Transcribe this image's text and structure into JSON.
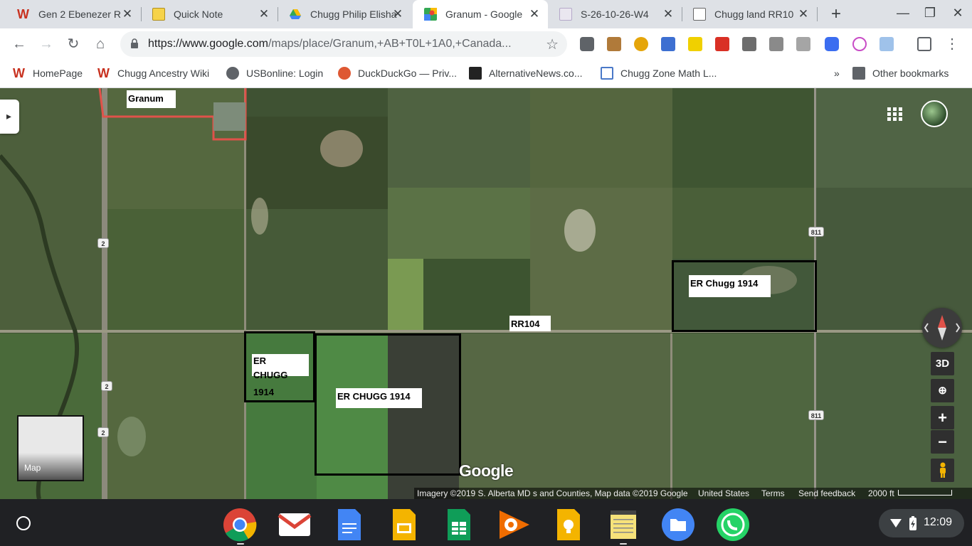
{
  "tabs": [
    {
      "title": "Gen 2 Ebenezer R",
      "icon": "wikitree-icon",
      "active": false
    },
    {
      "title": "Quick Note",
      "icon": "note-icon",
      "active": false
    },
    {
      "title": "Chugg Philip Elisha",
      "icon": "drive-icon",
      "active": false
    },
    {
      "title": "Granum - Google",
      "icon": "maps-icon",
      "active": true
    },
    {
      "title": "S-26-10-26-W4",
      "icon": "survey-icon",
      "active": false
    },
    {
      "title": "Chugg land RR10",
      "icon": "page-icon",
      "active": false
    }
  ],
  "toolbar": {
    "url_domain": "https://www.google.com",
    "url_path": "/maps/place/Granum,+AB+T0L+1A0,+Canada..."
  },
  "bookmarks": [
    {
      "label": "HomePage",
      "icon": "wikitree-icon"
    },
    {
      "label": "Chugg Ancestry Wiki",
      "icon": "wikitree-icon"
    },
    {
      "label": "USBonline: Login",
      "icon": "globe-icon"
    },
    {
      "label": "DuckDuckGo — Priv...",
      "icon": "duckduckgo-icon"
    },
    {
      "label": "AlternativeNews.co...",
      "icon": "chart-icon"
    },
    {
      "label": "Chugg Zone Math L...",
      "icon": "page-icon"
    },
    {
      "label": "Other bookmarks",
      "icon": "folder-icon"
    }
  ],
  "bookmarks_overflow": "»",
  "map": {
    "place_label": "Granum",
    "labels": {
      "rr104": "RR104",
      "plot_east": "ER Chugg 1914",
      "plot_small_l1": "ER",
      "plot_small_l2": "CHUGG",
      "plot_small_l3": "1914",
      "plot_mid": "ER CHUGG 1914"
    },
    "highway_2": "2",
    "highway_811": "811",
    "minimap_label": "Map",
    "controls": {
      "mode_3d": "3D",
      "zoom_in": "+",
      "zoom_out": "−"
    },
    "google_logo": "Google",
    "attribution": {
      "imagery": "Imagery ©2019 S. Alberta MD s and Counties, Map data ©2019 Google",
      "country": "United States",
      "terms": "Terms",
      "feedback": "Send feedback",
      "scale": "2000 ft"
    }
  },
  "shelf": {
    "apps": [
      "chrome-icon",
      "gmail-icon",
      "docs-icon",
      "slides-icon",
      "sheets-icon",
      "play-music-icon",
      "keep-icon",
      "notes-icon",
      "files-icon",
      "whatsapp-icon"
    ],
    "time": "12:09"
  }
}
